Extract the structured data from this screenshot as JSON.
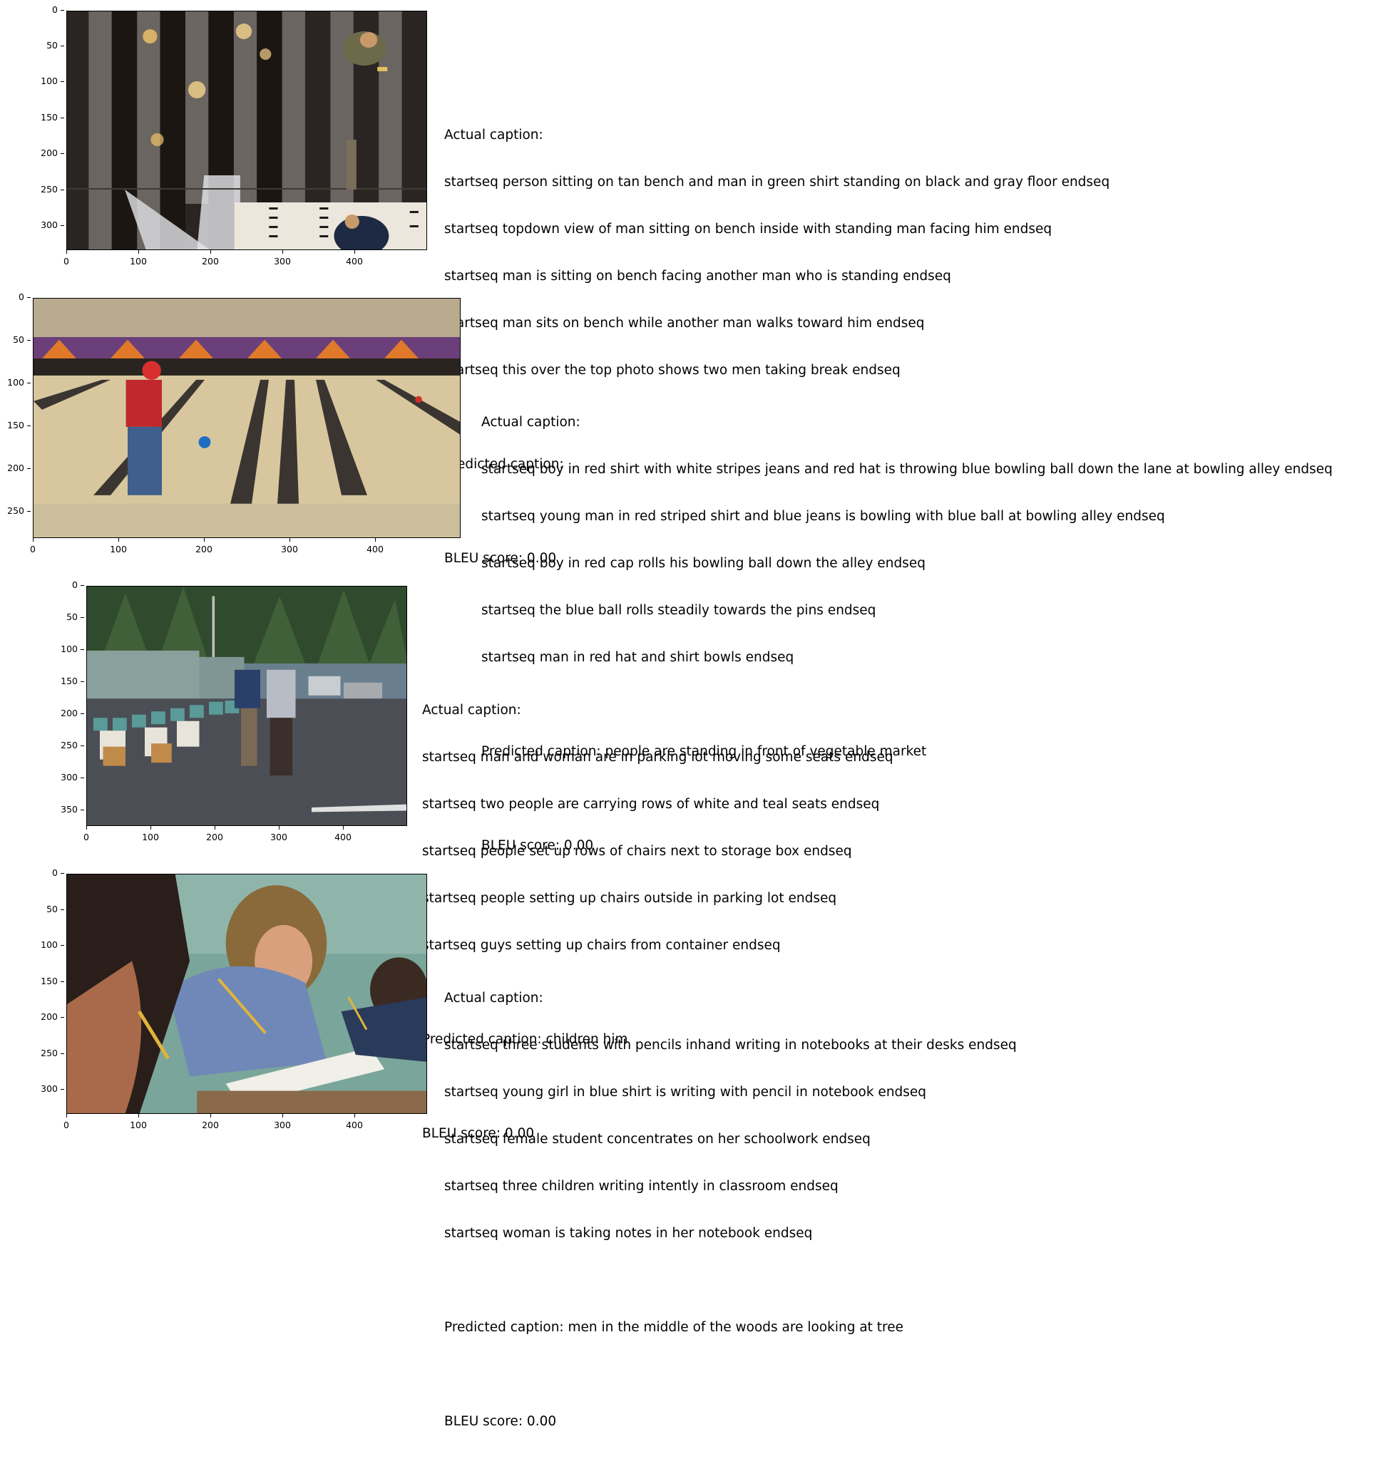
{
  "panels": [
    {
      "ytick_labels": [
        "0",
        "50",
        "100",
        "150",
        "200",
        "250",
        "300"
      ],
      "xtick_labels": [
        "0",
        "100",
        "200",
        "300",
        "400"
      ],
      "actual_label": "Actual caption:",
      "actual": [
        "startseq person sitting on tan bench and man in green shirt standing on black and gray floor endseq",
        "startseq topdown view of man sitting on bench inside with standing man facing him endseq",
        "startseq man is sitting on bench facing another man who is standing endseq",
        "startseq man sits on bench while another man walks toward him endseq",
        "startseq this over the top photo shows two men taking break endseq"
      ],
      "predicted": "Predicted caption:",
      "bleu": "BLEU score: 0.00"
    },
    {
      "ytick_labels": [
        "0",
        "50",
        "100",
        "150",
        "200",
        "250"
      ],
      "xtick_labels": [
        "0",
        "100",
        "200",
        "300",
        "400"
      ],
      "actual_label": "Actual caption:",
      "actual": [
        "startseq boy in red shirt with white stripes jeans and red hat is throwing blue bowling ball down the lane at bowling alley endseq",
        "startseq young man in red striped shirt and blue jeans is bowling with blue ball at bowling alley endseq",
        "startseq boy in red cap rolls his bowling ball down the alley endseq",
        "startseq the blue ball rolls steadily towards the pins endseq",
        "startseq man in red hat and shirt bowls endseq"
      ],
      "predicted": "Predicted caption: people are standing in front of vegetable market",
      "bleu": "BLEU score: 0.00"
    },
    {
      "ytick_labels": [
        "0",
        "50",
        "100",
        "150",
        "200",
        "250",
        "300",
        "350"
      ],
      "xtick_labels": [
        "0",
        "100",
        "200",
        "300",
        "400"
      ],
      "actual_label": "Actual caption:",
      "actual": [
        "startseq man and woman are in parking lot moving some seats endseq",
        "startseq two people are carrying rows of white and teal seats endseq",
        "startseq people set up rows of chairs next to storage box endseq",
        "startseq people setting up chairs outside in parking lot endseq",
        "startseq guys setting up chairs from container endseq"
      ],
      "predicted": "Predicted caption: children him",
      "bleu": "BLEU score: 0.00"
    },
    {
      "ytick_labels": [
        "0",
        "50",
        "100",
        "150",
        "200",
        "250",
        "300"
      ],
      "xtick_labels": [
        "0",
        "100",
        "200",
        "300",
        "400"
      ],
      "actual_label": "Actual caption:",
      "actual": [
        "startseq three students with pencils inhand writing in notebooks at their desks endseq",
        "startseq young girl in blue shirt is writing with pencil in notebook endseq",
        "startseq female student concentrates on her schoolwork endseq",
        "startseq three children writing intently in classroom endseq",
        "startseq woman is taking notes in her notebook endseq"
      ],
      "predicted": "Predicted caption: men in the middle of the woods are looking at tree",
      "bleu": "BLEU score: 0.00"
    }
  ]
}
